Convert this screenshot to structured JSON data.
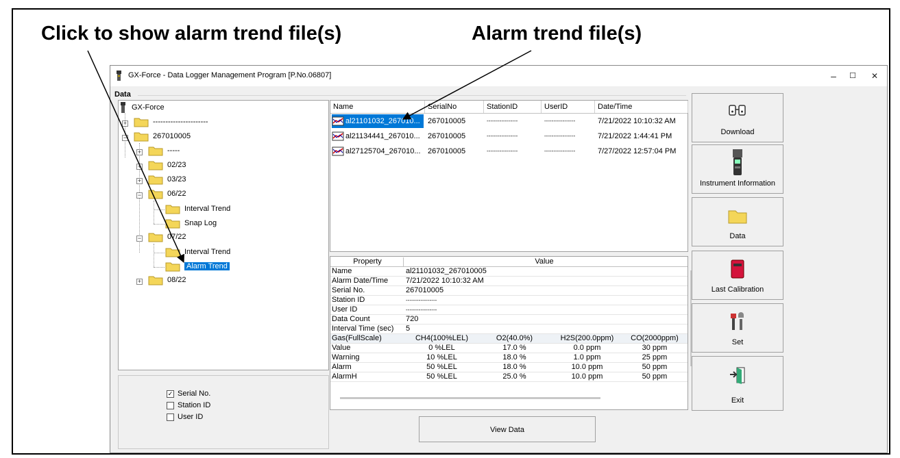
{
  "callouts": {
    "left": "Click to show alarm trend file(s)",
    "right": "Alarm trend file(s)"
  },
  "window": {
    "title": "GX-Force - Data Logger Management Program [P.No.06807]",
    "minimize": "–",
    "maximize": "☐",
    "close": "✕",
    "group_label": "Data"
  },
  "tree": {
    "root": "GX-Force",
    "items": [
      "----------------------",
      "267010005",
      "-----",
      "02/23",
      "03/23",
      "06/22",
      "Interval Trend",
      "Snap Log",
      "07/22",
      "Interval Trend",
      "Alarm Trend",
      "08/22"
    ]
  },
  "filters": {
    "serial": {
      "label": "Serial No.",
      "checked": true
    },
    "station": {
      "label": "Station ID",
      "checked": false
    },
    "user": {
      "label": "User ID",
      "checked": false
    }
  },
  "file_list": {
    "columns": [
      "Name",
      "SerialNo",
      "StationID",
      "UserID",
      "Date/Time"
    ],
    "rows": [
      [
        "al21101032_267010...",
        "267010005",
        "-----------------",
        "-----------------",
        "7/21/2022 10:10:32 AM"
      ],
      [
        "al21134441_267010...",
        "267010005",
        "-----------------",
        "-----------------",
        "7/21/2022 1:44:41 PM"
      ],
      [
        "al27125704_267010...",
        "267010005",
        "-----------------",
        "-----------------",
        "7/27/2022 12:57:04 PM"
      ]
    ]
  },
  "properties": {
    "header_property": "Property",
    "header_value": "Value",
    "rows": [
      {
        "k": "Name",
        "v": "al21101032_267010005"
      },
      {
        "k": "Alarm Date/Time",
        "v": "7/21/2022 10:10:32 AM"
      },
      {
        "k": "Serial No.",
        "v": "267010005"
      },
      {
        "k": "Station ID",
        "v": "-----------------"
      },
      {
        "k": "User ID",
        "v": "-----------------"
      },
      {
        "k": "Data Count",
        "v": "720"
      },
      {
        "k": "Interval Time (sec)",
        "v": "5"
      }
    ],
    "gas_rows": [
      {
        "k": "Gas(FullScale)",
        "cols": [
          "CH4(100%LEL)",
          "O2(40.0%)",
          "H2S(200.0ppm)",
          "CO(2000ppm)"
        ]
      },
      {
        "k": "Value",
        "cols": [
          "0 %LEL",
          "17.0 %",
          "0.0 ppm",
          "30 ppm"
        ]
      },
      {
        "k": "Warning",
        "cols": [
          "10 %LEL",
          "18.0 %",
          "1.0 ppm",
          "25 ppm"
        ]
      },
      {
        "k": "Alarm",
        "cols": [
          "50 %LEL",
          "18.0 %",
          "10.0 ppm",
          "50 ppm"
        ]
      },
      {
        "k": "AlarmH",
        "cols": [
          "50 %LEL",
          "25.0 %",
          "10.0 ppm",
          "50 ppm"
        ]
      }
    ]
  },
  "buttons": {
    "download": "Download",
    "instrument": "Instrument Information",
    "data": "Data",
    "calibration": "Last Calibration",
    "set": "Set",
    "exit": "Exit",
    "view_data": "View Data"
  }
}
